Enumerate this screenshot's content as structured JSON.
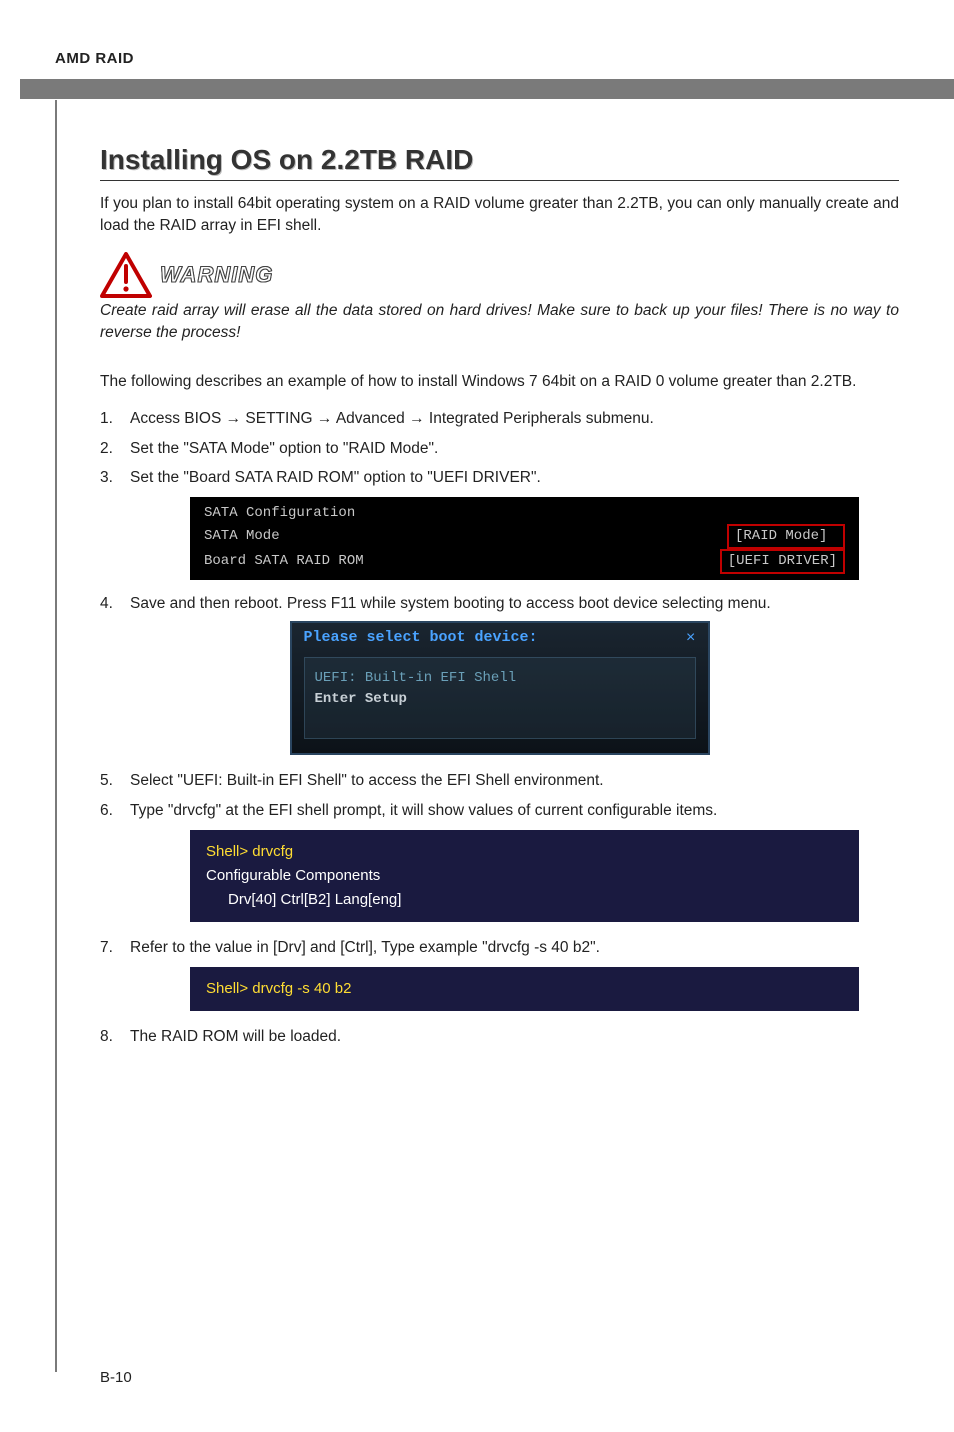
{
  "header": {
    "section_label": "AMD RAID"
  },
  "title": "Installing OS on 2.2TB RAID",
  "intro": "If you plan to install 64bit operating system on a RAID volume greater than 2.2TB, you can only manually create and load the RAID array in EFI shell.",
  "warning": {
    "label": "WARNING",
    "note": "Create raid array will erase all the data stored on hard drives! Make sure to back up your files! There is no way to reverse the process!"
  },
  "example_intro": "The following describes an example of how to install Windows 7 64bit on a RAID 0 volume greater than 2.2TB.",
  "steps": {
    "s1": "Access BIOS → SETTING → Advanced → Integrated Peripherals submenu.",
    "s2": "Set the \"SATA Mode\" option to \"RAID Mode\".",
    "s3": "Set the \"Board SATA RAID ROM\" option to \"UEFI DRIVER\".",
    "s4": "Save and then reboot. Press F11 while system booting to access boot device selecting menu.",
    "s5": "Select \"UEFI: Built-in EFI Shell\" to access the EFI Shell environment.",
    "s6": "Type \"drvcfg\" at the EFI shell prompt, it will show values of current configurable items.",
    "s7": "Refer to the value in [Drv] and [Ctrl], Type example \"drvcfg -s 40 b2\".",
    "s8": "The RAID ROM will be loaded."
  },
  "bios": {
    "line1": "SATA Configuration",
    "row2_label": "SATA Mode",
    "row2_value": "[RAID Mode]",
    "row3_label": "Board SATA RAID ROM",
    "row3_value": "[UEFI DRIVER]"
  },
  "boot_dialog": {
    "title": "Please select boot device:",
    "close": "×",
    "option1": "UEFI: Built-in EFI Shell",
    "option2": "Enter Setup"
  },
  "shell1": {
    "prompt": "Shell> drvcfg",
    "line2": "Configurable Components",
    "line3": "Drv[40]   Ctrl[B2]   Lang[eng]"
  },
  "shell2": {
    "prompt": "Shell> drvcfg -s 40 b2"
  },
  "page_num": "B-10"
}
